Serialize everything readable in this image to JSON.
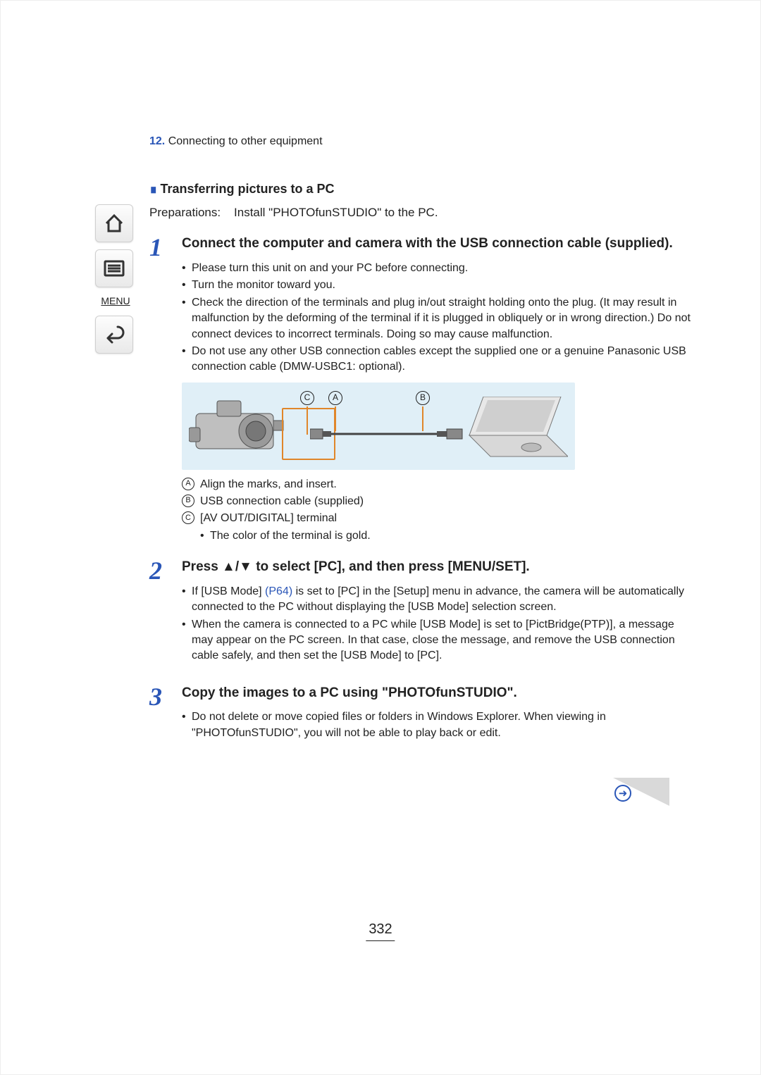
{
  "breadcrumb": {
    "num": "12.",
    "label": "Connecting to other equipment"
  },
  "side_nav": {
    "menu_label": "MENU"
  },
  "section": {
    "title": "Transferring pictures to a PC"
  },
  "preparations": {
    "label": "Preparations:",
    "text": "Install \"PHOTOfunSTUDIO\" to the PC."
  },
  "steps": [
    {
      "num": "1",
      "title": "Connect the computer and camera with the USB connection cable (supplied).",
      "bullets": [
        "Please turn this unit on and your PC before connecting.",
        "Turn the monitor toward you.",
        "Check the direction of the terminals and plug in/out straight holding onto the plug. (It may result in malfunction by the deforming of the terminal if it is plugged in obliquely or in wrong direction.) Do not connect devices to incorrect terminals. Doing so may cause malfunction.",
        "Do not use any other USB connection cables except the supplied one or a genuine Panasonic USB connection cable (DMW-USBC1: optional)."
      ],
      "legend": [
        {
          "marker": "A",
          "text": "Align the marks, and insert."
        },
        {
          "marker": "B",
          "text": "USB connection cable (supplied)"
        },
        {
          "marker": "C",
          "text": "[AV OUT/DIGITAL] terminal",
          "sub": "The color of the terminal is gold."
        }
      ],
      "diagram_labels": {
        "A": "A",
        "B": "B",
        "C": "C"
      }
    },
    {
      "num": "2",
      "title_pre": "Press ",
      "title_post": " to select [PC], and then press [MENU/SET].",
      "bullets_html": [
        {
          "pre": "If [USB Mode] ",
          "link": "(P64)",
          "post": " is set to [PC] in the [Setup] menu in advance, the camera will be automatically connected to the PC without displaying the [USB Mode] selection screen."
        },
        {
          "text": "When the camera is connected to a PC while [USB Mode] is set to [PictBridge(PTP)], a message may appear on the PC screen. In that case, close the message, and remove the USB connection cable safely, and then set the [USB Mode] to [PC]."
        }
      ]
    },
    {
      "num": "3",
      "title": "Copy the images to a PC using \"PHOTOfunSTUDIO\".",
      "bullets": [
        "Do not delete or move copied files or folders in Windows Explorer. When viewing in \"PHOTOfunSTUDIO\", you will not be able to play back or edit."
      ]
    }
  ],
  "page_number": "332"
}
